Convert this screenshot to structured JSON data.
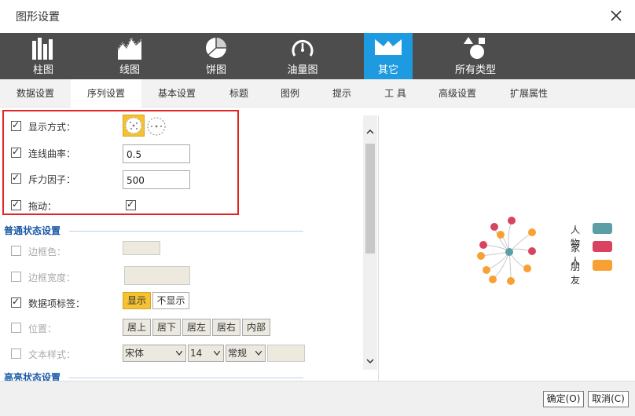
{
  "dialog": {
    "title": "图形设置"
  },
  "type_bar": [
    {
      "label": "柱图",
      "icon": "bar-chart-icon"
    },
    {
      "label": "线图",
      "icon": "line-chart-icon"
    },
    {
      "label": "饼图",
      "icon": "pie-chart-icon"
    },
    {
      "label": "油量图",
      "icon": "gauge-icon"
    },
    {
      "label": "其它",
      "icon": "other-chart-icon",
      "active": true
    },
    {
      "label": "所有类型",
      "icon": "shapes-icon"
    }
  ],
  "tabs": [
    {
      "label": "数据设置"
    },
    {
      "label": "序列设置",
      "active": true
    },
    {
      "label": "基本设置"
    },
    {
      "label": "标题"
    },
    {
      "label": "图例"
    },
    {
      "label": "提示"
    },
    {
      "label": "工 具"
    },
    {
      "label": "高级设置"
    },
    {
      "label": "扩展属性"
    }
  ],
  "settings": {
    "display_mode": {
      "label": "显示方式：",
      "checked": true
    },
    "line_curvature": {
      "label": "连线曲率：",
      "checked": true,
      "value": "0.5"
    },
    "repulsion": {
      "label": "斥力因子：",
      "checked": true,
      "value": "500"
    },
    "drag": {
      "label": "拖动：",
      "checked": true,
      "value_checked": true
    }
  },
  "normal_state": {
    "title": "普通状态设置",
    "border_color": {
      "label": "边框色：",
      "checked": false
    },
    "border_width": {
      "label": "边框宽度：",
      "checked": false
    },
    "data_label": {
      "label": "数据项标签：",
      "checked": true,
      "options": [
        "显示",
        "不显示"
      ],
      "selected": "显示"
    },
    "position": {
      "label": "位置：",
      "checked": false,
      "options": [
        "居上",
        "居下",
        "居左",
        "居右",
        "内部"
      ]
    },
    "text_style": {
      "label": "文本样式：",
      "checked": false,
      "font": "宋体",
      "size": "14",
      "weight": "常规"
    }
  },
  "highlight_state": {
    "title": "高亮状态设置"
  },
  "preview": {
    "legend": [
      {
        "label": "人物",
        "color": "#5b9ea6"
      },
      {
        "label": "家人",
        "color": "#d9435f"
      },
      {
        "label": "朋友",
        "color": "#f7a135"
      }
    ]
  },
  "footer": {
    "ok_label": "确定(O)",
    "cancel_label": "取消(C)"
  }
}
